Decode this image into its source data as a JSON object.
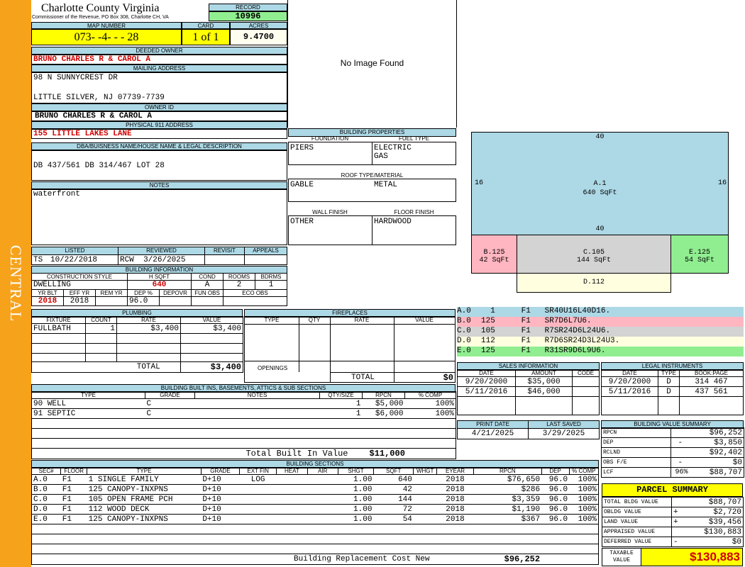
{
  "sidebar": {
    "label": "CENTRAL"
  },
  "header": {
    "county": "Charlotte County Virginia",
    "address": "Commissioner of the Revenue, PO Box 308, Charlotte CH, VA",
    "record_label": "RECORD",
    "record": "10996"
  },
  "parcel": {
    "map_label": "MAP NUMBER",
    "map": "073- -4- - - 28",
    "card_label": "CARD",
    "card": "1 of 1",
    "acres_label": "ACRES",
    "acres": "9.4700"
  },
  "owner": {
    "deeded_label": "DEEDED OWNER",
    "deeded": "BRUNO CHARLES R & CAROL A",
    "mailing_label": "MAILING ADDRESS",
    "mail1": "98 N SUNNYCREST DR",
    "mail2": "LITTLE SILVER, NJ 07739-7739",
    "owner_id_label": "OWNER ID",
    "owner_id": "BRUNO CHARLES R & CAROL A",
    "physical_label": "PHYSICAL 911 ADDRESS",
    "physical": "155 LITTLE LAKES LANE",
    "dba_label": "DBA/BUISNESS NAME/HOUSE NAME & LEGAL DESCRIPTION",
    "dba": "DB 437/561 DB 314/467 LOT 28",
    "notes_label": "NOTES",
    "notes": "waterfront"
  },
  "listing": {
    "listed_label": "LISTED",
    "listed_by": "TS",
    "listed_date": "10/22/2018",
    "reviewed_label": "REVIEWED",
    "reviewed_by": "RCW",
    "reviewed_date": "3/26/2025",
    "revisit_label": "REVISIT",
    "appeals_label": "APPEALS"
  },
  "building_info": {
    "title": "BUILDING INFORMATION",
    "style_label": "CONSTRUCTION STYLE",
    "style": "DWELLING",
    "hsqft_label": "H SQFT",
    "hsqft": "640",
    "cond_label": "COND",
    "cond": "A",
    "rooms_label": "ROOMS",
    "rooms": "2",
    "bdrms_label": "BDRMS",
    "bdrms": "1",
    "yrblt_label": "YR BLT",
    "yrblt": "2018",
    "effyr_label": "EFF YR",
    "effyr": "2018",
    "remyr_label": "REM YR",
    "dep_label": "DEP %",
    "dep": "96.0",
    "depovr_label": "DEPOVR",
    "funobs_label": "FUN OBS",
    "ecoobs_label": "ECO OBS"
  },
  "image": {
    "text": "No Image Found"
  },
  "props": {
    "title": "BUILDING PROPERTIES",
    "foundation_label": "FOUNDATION",
    "foundation": "PIERS",
    "fuel_label": "FUEL TYPE",
    "fuel1": "ELECTRIC",
    "fuel2": "GAS",
    "roof_label": "ROOF TYPE/MATERIAL",
    "roof_type": "GABLE",
    "roof_mat": "METAL",
    "wall_label": "WALL FINISH",
    "wall": "OTHER",
    "floor_label": "FLOOR FINISH",
    "floor": "HARDWOOD"
  },
  "sketch": {
    "a_top": "40",
    "a_left": "16",
    "a_right": "16",
    "a_bottom": "40",
    "a_name": "A.1",
    "a_area": "640 SqFt",
    "b_name": "B.125",
    "b_area": "42 SqFt",
    "c_name": "C.105",
    "c_area": "144 SqFt",
    "e_name": "E.125",
    "e_area": "54 SqFt",
    "d_name": "D.112",
    "colors": {
      "a": "#add8e6",
      "b": "#ffb6c1",
      "c": "#d3d3d3",
      "d": "#ffffe0",
      "e": "#90ee90"
    }
  },
  "vectors": [
    {
      "sec": "A.0",
      "code": "1",
      "floor": "F1",
      "vec": "SR40U16L40D16."
    },
    {
      "sec": "B.0",
      "code": "125",
      "floor": "F1",
      "vec": "SR7D6L7U6."
    },
    {
      "sec": "C.0",
      "code": "105",
      "floor": "F1",
      "vec": "R7SR24D6L24U6."
    },
    {
      "sec": "D.0",
      "code": "112",
      "floor": "F1",
      "vec": "R7D6SR24D3L24U3."
    },
    {
      "sec": "E.0",
      "code": "125",
      "floor": "F1",
      "vec": "R31SR9D6L9U6."
    }
  ],
  "plumbing": {
    "title": "PLUMBING",
    "h_fixture": "FIXTURE",
    "h_count": "COUNT",
    "h_rate": "RATE",
    "h_value": "VALUE",
    "rows": [
      {
        "fixture": "FULLBATH",
        "count": "1",
        "rate": "$3,400",
        "value": "$3,400"
      }
    ],
    "total_label": "TOTAL",
    "total": "$3,400"
  },
  "fireplaces": {
    "title": "FIREPLACES",
    "h_type": "TYPE",
    "h_qty": "QTY",
    "h_rate": "RATE",
    "h_value": "VALUE",
    "openings_label": "OPENINGS",
    "total_label": "TOTAL",
    "total": "$0"
  },
  "sales": {
    "title": "SALES INFORMATION",
    "h_date": "DATE",
    "h_amount": "AMOUNT",
    "h_code": "CODE",
    "rows": [
      {
        "date": "9/20/2000",
        "amount": "$35,000",
        "code": ""
      },
      {
        "date": "5/11/2016",
        "amount": "$46,000",
        "code": ""
      }
    ]
  },
  "legal": {
    "title": "LEGAL INSTRUMENTS",
    "h_date": "DATE",
    "h_type": "TYPE",
    "h_book": "BOOK:PAGE",
    "rows": [
      {
        "date": "9/20/2000",
        "type": "D",
        "book": "314 467"
      },
      {
        "date": "5/11/2016",
        "type": "D",
        "book": "437 561"
      }
    ]
  },
  "builtins": {
    "title": "BUILDING BUILT INS, BASEMENTS, ATTICS & SUB SECTIONS",
    "h_type": "TYPE",
    "h_grade": "GRADE",
    "h_notes": "NOTES",
    "h_qty": "QTY/SIZE",
    "h_rpcn": "RPCN",
    "h_comp": "% COMP",
    "rows": [
      {
        "type": "90 WELL",
        "grade": "C",
        "notes": "",
        "qty": "1",
        "rpcn": "$5,000",
        "comp": "100%"
      },
      {
        "type": "91 SEPTIC",
        "grade": "C",
        "notes": "",
        "qty": "1",
        "rpcn": "$6,000",
        "comp": "100%"
      }
    ],
    "total_label": "Total Built In Value",
    "total": "$11,000"
  },
  "print": {
    "print_label": "PRINT DATE",
    "print_date": "4/21/2025",
    "saved_label": "LAST SAVED",
    "saved_date": "3/29/2025"
  },
  "value_summary": {
    "title": "BUILDING VALUE SUMMARY",
    "rows": [
      {
        "label": "RPCN",
        "sign": "",
        "value": "$96,252"
      },
      {
        "label": "DEP",
        "sign": "-",
        "value": "$3,850"
      },
      {
        "label": "RCLND",
        "sign": "",
        "value": "$92,402"
      },
      {
        "label": "OBS F/E",
        "sign": "-",
        "value": "$0"
      },
      {
        "label": "LCF",
        "sign": "96%",
        "value": "$88,707"
      }
    ]
  },
  "parcel_summary": {
    "title": "PARCEL SUMMARY",
    "rows": [
      {
        "label": "TOTAL BLDG VALUE",
        "sign": "",
        "value": "$88,707"
      },
      {
        "label": "OBLDG VALUE",
        "sign": "+",
        "value": "$2,720"
      },
      {
        "label": "LAND VALUE",
        "sign": "+",
        "value": "$39,456"
      },
      {
        "label": "APPRAISED VALUE",
        "sign": "",
        "value": "$130,883"
      },
      {
        "label": "DEFERRED VALUE",
        "sign": "-",
        "value": "$0"
      }
    ],
    "taxable_label1": "TAXABLE",
    "taxable_label2": "VALUE",
    "taxable": "$130,883"
  },
  "sections": {
    "title": "BUILDING SECTIONS",
    "h": [
      "SEC#",
      "FLOOR",
      "TYPE",
      "GRADE",
      "EXT FIN",
      "HEAT",
      "AIR",
      "SHGT",
      "SQFT",
      "WHGT",
      "EYEAR",
      "RPCN",
      "DEP",
      "% COMP"
    ],
    "rows": [
      {
        "sec": "A.0",
        "floor": "F1",
        "type": "1 SINGLE FAMILY",
        "grade": "D+10",
        "ext": "LOG",
        "heat": "",
        "air": "",
        "shgt": "1.00",
        "sqft": "640",
        "whgt": "",
        "eyear": "2018",
        "rpcn": "$76,650",
        "dep": "96.0",
        "comp": "100%"
      },
      {
        "sec": "B.0",
        "floor": "F1",
        "type": "125 CANOPY-INXPNS",
        "grade": "D+10",
        "ext": "",
        "heat": "",
        "air": "",
        "shgt": "1.00",
        "sqft": "42",
        "whgt": "",
        "eyear": "2018",
        "rpcn": "$286",
        "dep": "96.0",
        "comp": "100%"
      },
      {
        "sec": "C.0",
        "floor": "F1",
        "type": "105 OPEN FRAME PCH",
        "grade": "D+10",
        "ext": "",
        "heat": "",
        "air": "",
        "shgt": "1.00",
        "sqft": "144",
        "whgt": "",
        "eyear": "2018",
        "rpcn": "$3,359",
        "dep": "96.0",
        "comp": "100%"
      },
      {
        "sec": "D.0",
        "floor": "F1",
        "type": "112 WOOD DECK",
        "grade": "D+10",
        "ext": "",
        "heat": "",
        "air": "",
        "shgt": "1.00",
        "sqft": "72",
        "whgt": "",
        "eyear": "2018",
        "rpcn": "$1,190",
        "dep": "96.0",
        "comp": "100%"
      },
      {
        "sec": "E.0",
        "floor": "F1",
        "type": "125 CANOPY-INXPNS",
        "grade": "D+10",
        "ext": "",
        "heat": "",
        "air": "",
        "shgt": "1.00",
        "sqft": "54",
        "whgt": "",
        "eyear": "2018",
        "rpcn": "$367",
        "dep": "96.0",
        "comp": "100%"
      }
    ],
    "total_label": "Building Replacement Cost New",
    "total": "$96,252"
  }
}
